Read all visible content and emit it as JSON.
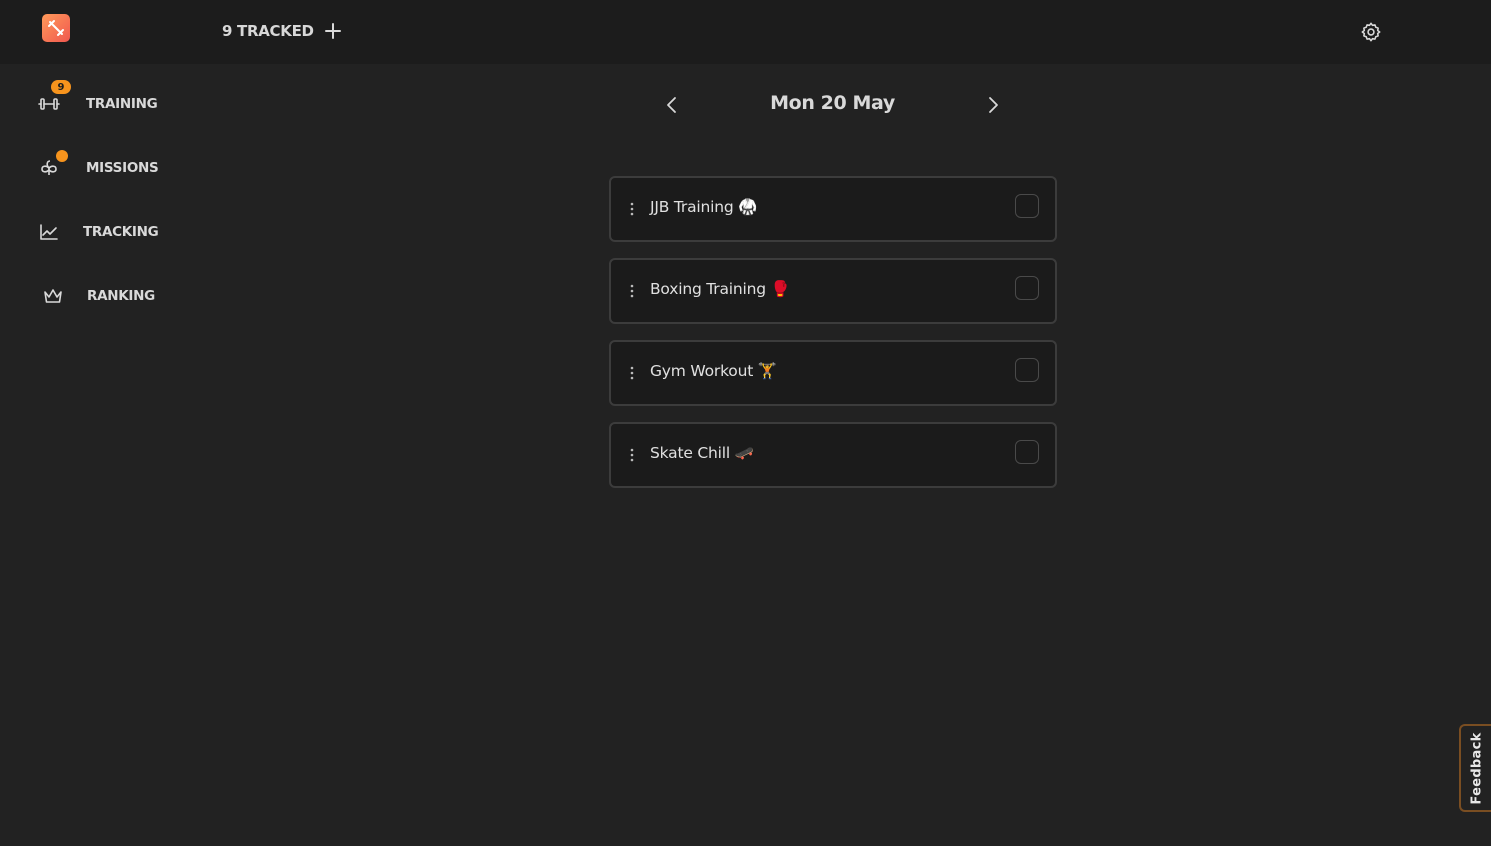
{
  "header": {
    "tracked_label": "9 TRACKED",
    "icons": {
      "logo": "app-logo-icon",
      "add": "plus-icon",
      "settings": "gear-icon"
    }
  },
  "sidebar": {
    "items": [
      {
        "label": "TRAINING",
        "icon": "dumbbell-icon",
        "badge": "9"
      },
      {
        "label": "MISSIONS",
        "icon": "clover-icon",
        "badge_dot": true
      },
      {
        "label": "TRACKING",
        "icon": "chart-line-icon"
      },
      {
        "label": "RANKING",
        "icon": "crown-icon"
      }
    ]
  },
  "date_nav": {
    "label": "Mon 20 May"
  },
  "tasks": [
    {
      "label": "JJB Training 🥋",
      "checked": false
    },
    {
      "label": "Boxing Training 🥊",
      "checked": false
    },
    {
      "label": "Gym Workout 🏋️",
      "checked": false
    },
    {
      "label": "Skate Chill 🛹",
      "checked": false
    }
  ],
  "feedback": {
    "label": "Feedback"
  },
  "colors": {
    "background": "#222222",
    "topbar": "#1c1c1c",
    "accent": "#f7941d",
    "card_border": "#3c3c3c",
    "text": "#d9d9d9"
  }
}
